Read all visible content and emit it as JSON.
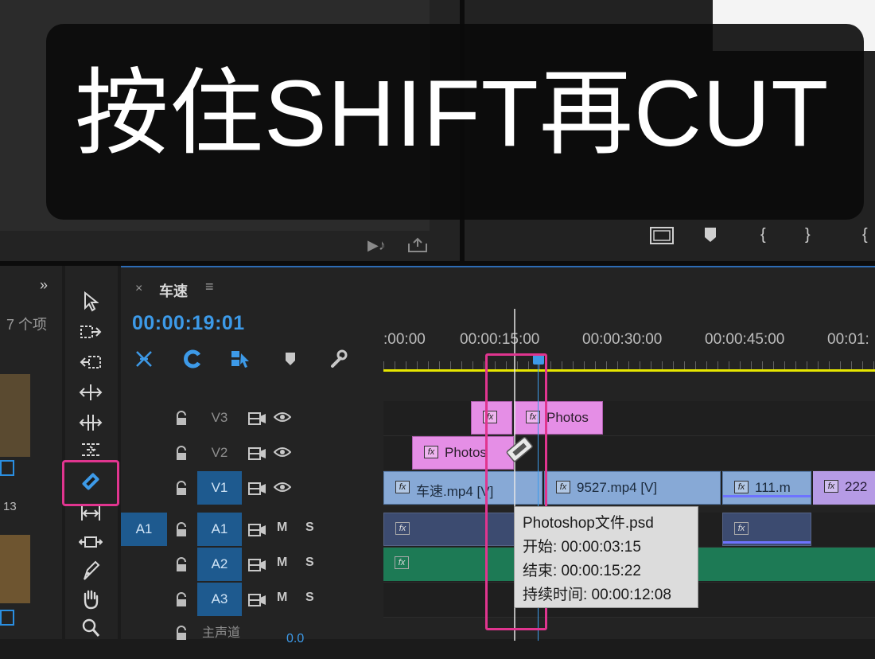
{
  "caption": {
    "text": "按住SHIFT再CUT"
  },
  "project_panel": {
    "item_count": "7 个项",
    "overflow_chevron": "»",
    "number_13": "13"
  },
  "program_monitor": {
    "controls": [
      "marker",
      "in-point",
      "out-point"
    ]
  },
  "timeline": {
    "sequence_name": "车速",
    "close_label": "×",
    "menu_label": "≡",
    "timecode": "00:00:19:01",
    "ruler_labels": [
      ":00:00",
      "00:00:15:00",
      "00:00:30:00",
      "00:00:45:00",
      "00:01:"
    ],
    "tracks": {
      "v3": "V3",
      "v2": "V2",
      "v1": "V1",
      "a1_source": "A1",
      "a1": "A1",
      "a2": "A2",
      "a3": "A3",
      "master": "主声道",
      "master_volume": "0.0",
      "mute": "M",
      "solo": "S"
    },
    "clips": {
      "v3_a": "fx",
      "v3_b": "Photos",
      "v2": "Photos",
      "v1_a": "车速.mp4 [V]",
      "v1_b": "9527.mp4 [V]",
      "v1_c": "111.m",
      "v1_d": "222",
      "fx": "fx"
    }
  },
  "tooltip": {
    "title": "Photoshop文件.psd",
    "start": "开始: 00:00:03:15",
    "end": "结束: 00:00:15:22",
    "duration": "持续时间: 00:00:12:08"
  },
  "colors": {
    "accent": "#3d9ae8",
    "highlight": "#e0358f",
    "ruler": "#e6e600",
    "clip_pink": "#e58ee6",
    "clip_blue": "#87a9d6",
    "clip_purple": "#b69be5",
    "clip_audio": "#3c4b70",
    "clip_green": "#1d7a55"
  }
}
